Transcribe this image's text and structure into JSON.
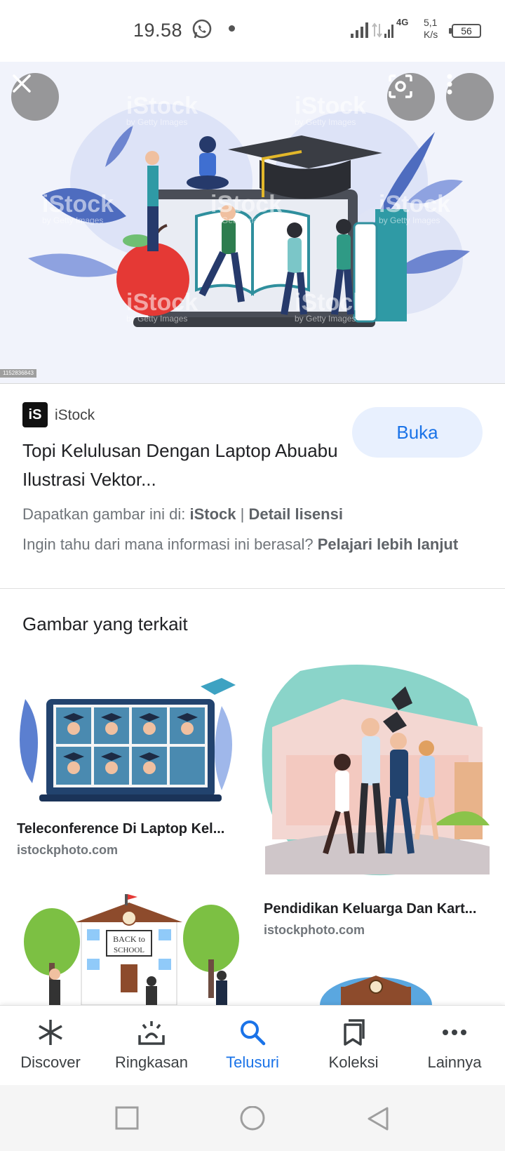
{
  "status_bar": {
    "time": "19.58",
    "network": "4G",
    "speed_value": "5,1",
    "speed_unit": "K/s",
    "battery": "56"
  },
  "hero": {
    "image_id": "1152836843",
    "watermark": "iStock",
    "watermark_sub": "by Getty Images"
  },
  "info": {
    "source_logo": "iS",
    "source_name": "iStock",
    "open_button": "Buka",
    "title": "Topi Kelulusan Dengan Laptop Abuabu Ilustrasi Vektor...",
    "get_image_prefix": "Dapatkan gambar ini di: ",
    "get_image_source": "iStock",
    "separator": " | ",
    "license_link": "Detail lisensi",
    "where_from": "Ingin tahu dari mana informasi ini berasal? ",
    "learn_more": "Pelajari lebih lanjut"
  },
  "related": {
    "heading": "Gambar yang terkait",
    "items": [
      {
        "caption": "Teleconference Di Laptop Kel...",
        "source": "istockphoto.com"
      },
      {
        "caption": "Pendidikan Keluarga Dan Kart...",
        "source": "istockphoto.com"
      }
    ],
    "school_sign_1": "BACK to",
    "school_sign_2": "SCHOOL"
  },
  "bottom_nav": {
    "items": [
      {
        "label": "Discover",
        "icon": "asterisk-icon"
      },
      {
        "label": "Ringkasan",
        "icon": "sunrise-icon"
      },
      {
        "label": "Telusuri",
        "icon": "search-icon"
      },
      {
        "label": "Koleksi",
        "icon": "bookmarks-icon"
      },
      {
        "label": "Lainnya",
        "icon": "more-horiz-icon"
      }
    ],
    "active_index": 2
  },
  "colors": {
    "accent": "#1a73e8",
    "chip_bg": "#e8f0fe"
  }
}
